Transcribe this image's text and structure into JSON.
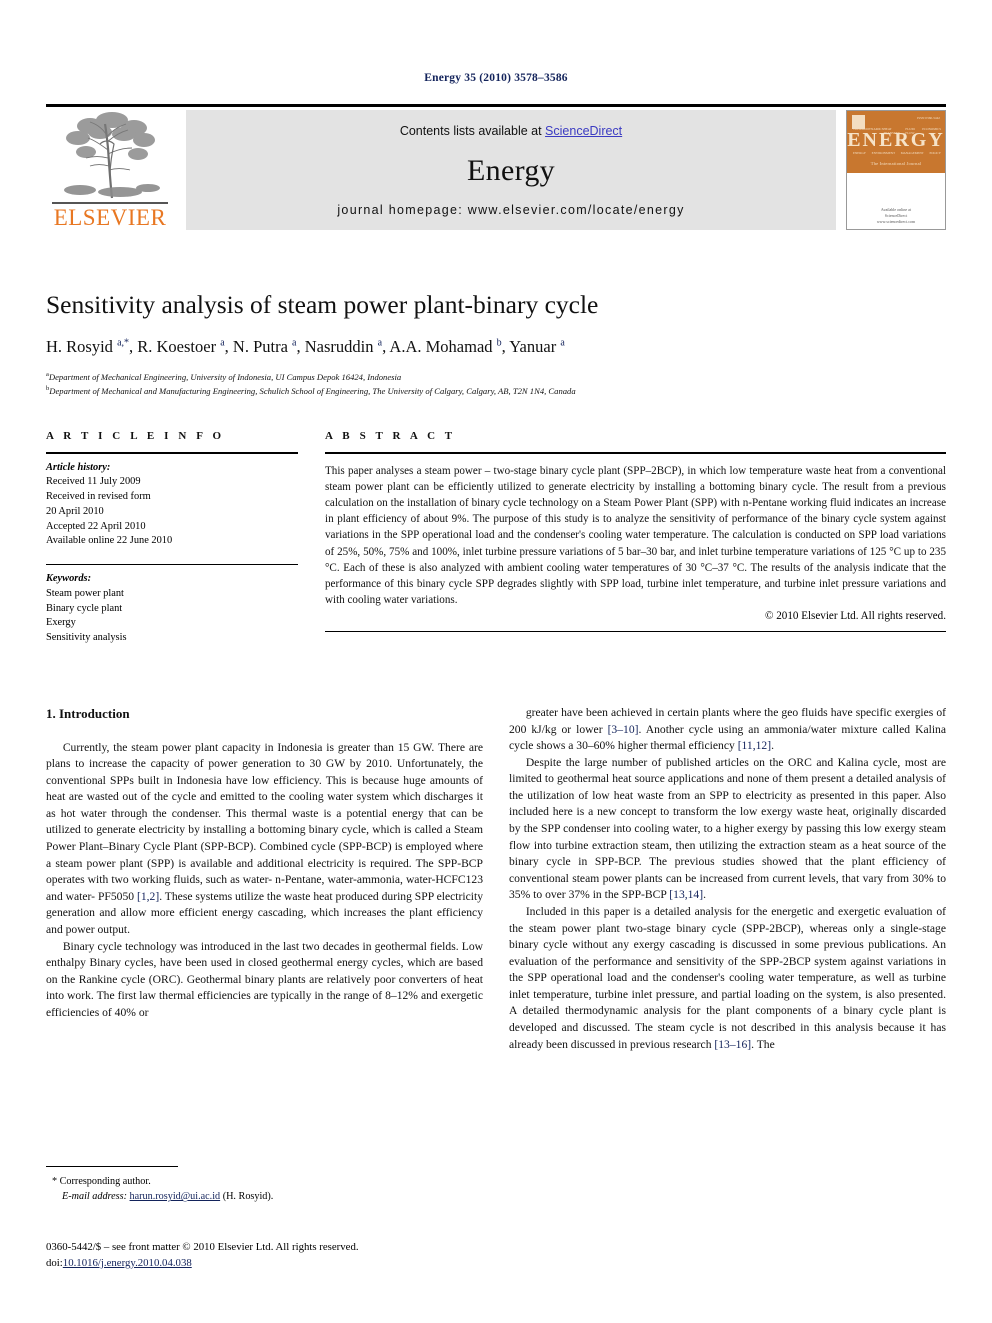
{
  "running_head": "Energy 35 (2010) 3578–3586",
  "masthead": {
    "publisher": "ELSEVIER",
    "publisher_logo_name": "elsevier-tree-logo",
    "contents_prefix": "Contents lists available at ",
    "contents_link": "ScienceDirect",
    "journal_title": "Energy",
    "homepage": "journal homepage: www.elsevier.com/locate/energy",
    "cover": {
      "title": "ENERGY",
      "subtitle": "The International Journal",
      "issue_code": "ISSN 0360-5442",
      "top_labels": [
        "THERMODYNAMICS",
        "HEAT TRANSFER",
        "FLUID FLOW",
        "ECONOMICS"
      ],
      "bottom_labels": [
        "ENERGY",
        "ENVIRONMENT",
        "MANAGEMENT",
        "POLICY"
      ],
      "footer_line1": "Available online at",
      "footer_line2": "ScienceDirect",
      "footer_line3": "www.sciencedirect.com"
    },
    "accent_orange": "#E87722",
    "link_blue": "#3b3bc2",
    "band_gray": "#e3e3e3"
  },
  "article": {
    "title": "Sensitivity analysis of steam power plant-binary cycle",
    "authors_html": "H. Rosyid <sup>a,*</sup>, R. Koestoer <sup>a</sup>, N. Putra <sup>a</sup>, Nasruddin <sup>a</sup>, A.A. Mohamad <sup>b</sup>, Yanuar <sup>a</sup>",
    "affiliation_a": "Department of Mechanical Engineering, University of Indonesia, UI Campus Depok 16424, Indonesia",
    "affiliation_b": "Department of Mechanical and Manufacturing Engineering, Schulich School of Engineering, The University of Calgary, Calgary, AB, T2N 1N4, Canada",
    "affiliation_a_marker": "a",
    "affiliation_b_marker": "b"
  },
  "article_info": {
    "heading": "A R T I C L E  I N F O",
    "history_label": "Article history:",
    "history": [
      "Received 11 July 2009",
      "Received in revised form",
      "20 April 2010",
      "Accepted 22 April 2010",
      "Available online 22 June 2010"
    ],
    "keywords_label": "Keywords:",
    "keywords": [
      "Steam power plant",
      "Binary cycle plant",
      "Exergy",
      "Sensitivity analysis"
    ]
  },
  "abstract": {
    "heading": "A B S T R A C T",
    "text": "This paper analyses a steam power – two-stage binary cycle plant (SPP–2BCP), in which low temperature waste heat from a conventional steam power plant can be efficiently utilized to generate electricity by installing a bottoming binary cycle. The result from a previous calculation on the installation of binary cycle technology on a Steam Power Plant (SPP) with n-Pentane working fluid indicates an increase in plant efficiency of about 9%. The purpose of this study is to analyze the sensitivity of performance of the binary cycle system against variations in the SPP operational load and the condenser's cooling water temperature. The calculation is conducted on SPP load variations of 25%, 50%, 75% and 100%, inlet turbine pressure variations of 5 bar–30 bar, and inlet turbine temperature variations of 125 °C up to 235 °C. Each of these is also analyzed with ambient cooling water temperatures of 30 °C–37 °C. The results of the analysis indicate that the performance of this binary cycle SPP degrades slightly with SPP load, turbine inlet temperature, and turbine inlet pressure variations and with cooling water variations.",
    "copyright": "© 2010 Elsevier Ltd. All rights reserved."
  },
  "body": {
    "section_number_title": "1.  Introduction",
    "left_paragraphs": [
      "Currently, the steam power plant capacity in Indonesia is greater than 15 GW. There are plans to increase the capacity of power generation to 30 GW by 2010. Unfortunately, the conventional SPPs built in Indonesia have low efficiency. This is because huge amounts of heat are wasted out of the cycle and emitted to the cooling water system which discharges it as hot water through the condenser. This thermal waste is a potential energy that can be utilized to generate electricity by installing a bottoming binary cycle, which is called a Steam Power Plant–Binary Cycle Plant (SPP-BCP). Combined cycle (SPP-BCP) is employed where a steam power plant (SPP) is available and additional electricity is required. The SPP-BCP operates with two working fluids, such as water- n-Pentane, water-ammonia, water-HCFC123 and water- PF5050 [1,2]. These systems utilize the waste heat produced during SPP electricity generation and allow more efficient energy cascading, which increases the plant efficiency and power output.",
      "Binary cycle technology was introduced in the last two decades in geothermal fields. Low enthalpy Binary cycles, have been used in closed geothermal energy cycles, which are based on the Rankine cycle (ORC). Geothermal binary plants are relatively poor converters of heat into work. The first law thermal efficiencies are typically in the range of 8–12% and exergetic efficiencies of 40% or"
    ],
    "right_paragraphs": [
      "greater have been achieved in certain plants where the geo fluids have specific exergies of 200 kJ/kg or lower [3–10]. Another cycle using an ammonia/water mixture called Kalina cycle shows a 30–60% higher thermal efficiency [11,12].",
      "Despite the large number of published articles on the ORC and Kalina cycle, most are limited to geothermal heat source applications and none of them present a detailed analysis of the utilization of low heat waste from an SPP to electricity as presented in this paper. Also included here is a new concept to transform the low exergy waste heat, originally discarded by the SPP condenser into cooling water, to a higher exergy by passing this low exergy steam flow into turbine extraction steam, then utilizing the extraction steam as a heat source of the binary cycle in SPP-BCP. The previous studies showed that the plant efficiency of conventional steam power plants can be increased from current levels, that vary from 30% to 35% to over 37% in the SPP-BCP [13,14].",
      "Included in this paper is a detailed analysis for the energetic and exergetic evaluation of the steam power plant two-stage binary cycle (SPP-2BCP), whereas only a single-stage binary cycle without any exergy cascading is discussed in some previous publications. An evaluation of the performance and sensitivity of the SPP-2BCP system against variations in the SPP operational load and the condenser's cooling water temperature, as well as turbine inlet temperature, turbine inlet pressure, and partial loading on the system, is also presented. A detailed thermodynamic analysis for the plant components of a binary cycle plant is developed and discussed. The steam cycle is not described in this analysis because it has already been discussed in previous research [13–16]. The"
    ],
    "reference_marks": [
      "[1,2]",
      "[3–10]",
      "[11,12]",
      "[13,14]",
      "[13–16]"
    ]
  },
  "footnote": {
    "corresponding": "* Corresponding author.",
    "email_label": "E-mail address:",
    "email": "harun.rosyid@ui.ac.id",
    "email_owner": "(H. Rosyid).",
    "issn_line": "0360-5442/$ – see front matter © 2010 Elsevier Ltd. All rights reserved.",
    "doi_prefix": "doi:",
    "doi": "10.1016/j.energy.2010.04.038"
  }
}
